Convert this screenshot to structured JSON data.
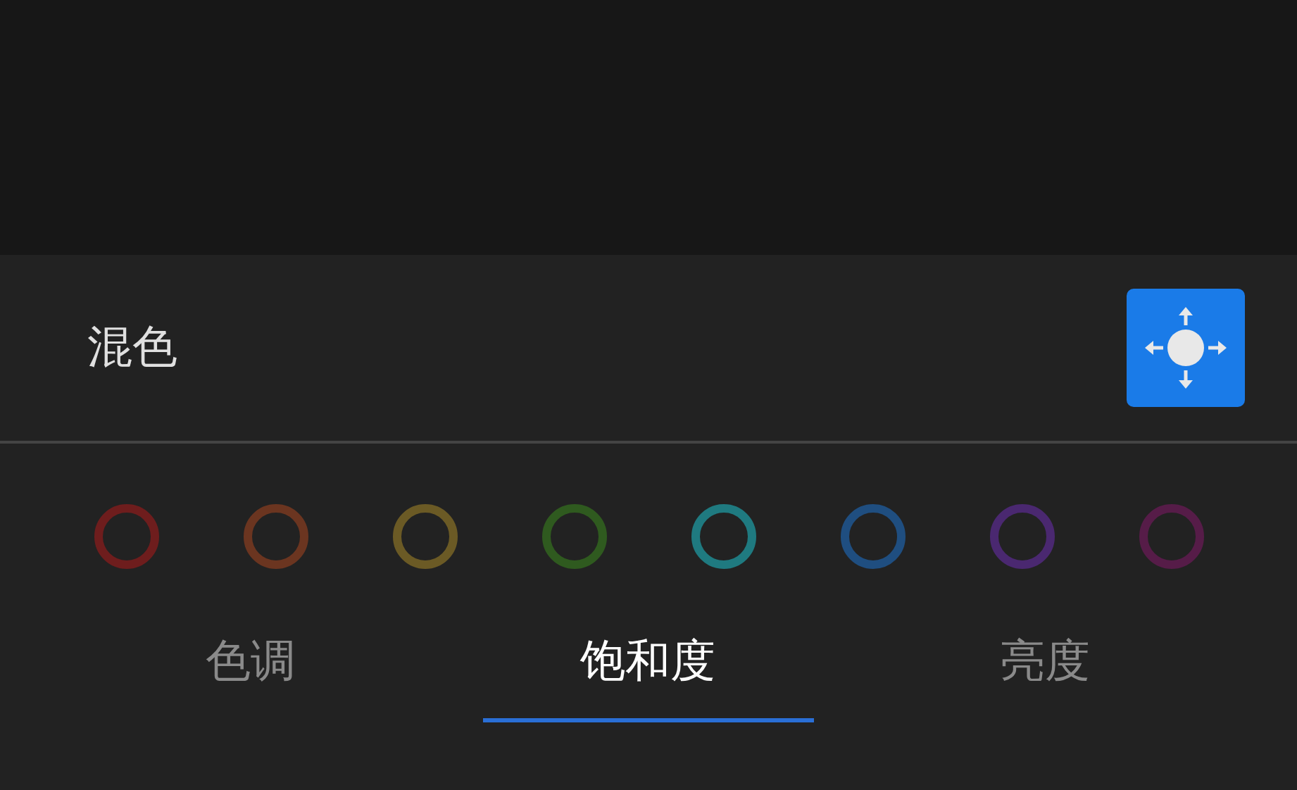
{
  "panel": {
    "title": "混色"
  },
  "colors": [
    {
      "color": "#6e1d1d"
    },
    {
      "color": "#6b3520"
    },
    {
      "color": "#6b5a25"
    },
    {
      "color": "#2f5a1f"
    },
    {
      "color": "#1f7a80"
    },
    {
      "color": "#1f4e80"
    },
    {
      "color": "#4a2870"
    },
    {
      "color": "#561c48"
    }
  ],
  "tabs": [
    {
      "label": "色调",
      "selected": false
    },
    {
      "label": "饱和度",
      "selected": true
    },
    {
      "label": "亮度",
      "selected": false
    }
  ]
}
